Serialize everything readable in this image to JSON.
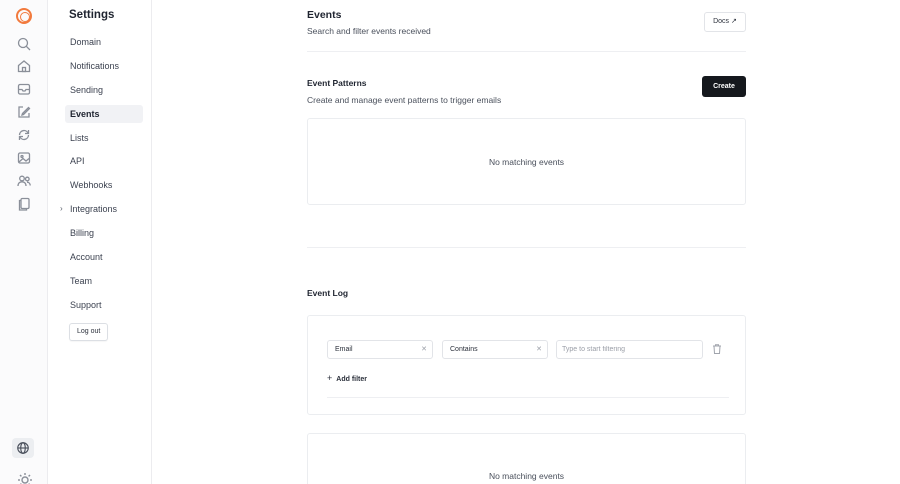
{
  "rail": {
    "icons": [
      "search-icon",
      "home-icon",
      "inbox-icon",
      "compose-icon",
      "sync-icon",
      "media-icon",
      "users-icon",
      "documents-icon"
    ],
    "bottom_icons": [
      "globe-icon",
      "sun-icon"
    ]
  },
  "nav": {
    "title": "Settings",
    "items": [
      {
        "label": "Domain"
      },
      {
        "label": "Notifications"
      },
      {
        "label": "Sending"
      },
      {
        "label": "Events",
        "active": true
      },
      {
        "label": "Lists"
      },
      {
        "label": "API"
      },
      {
        "label": "Webhooks"
      },
      {
        "label": "Integrations",
        "expandable": true
      },
      {
        "label": "Billing"
      },
      {
        "label": "Account"
      },
      {
        "label": "Team"
      },
      {
        "label": "Support"
      }
    ],
    "logout_label": "Log out"
  },
  "header": {
    "title": "Events",
    "subtitle": "Search and filter events received",
    "docs_label": "Docs ↗"
  },
  "patterns": {
    "title": "Event Patterns",
    "subtitle": "Create and manage event patterns to trigger emails",
    "create_label": "Create",
    "empty_text": "No matching events"
  },
  "log": {
    "title": "Event Log",
    "filter": {
      "field_value": "Email",
      "operator_value": "Contains",
      "value_placeholder": "Type to start filtering",
      "clear_glyph": "✕"
    },
    "add_filter_label": "Add filter",
    "empty_text": "No matching events"
  },
  "colors": {
    "brand": "#f27a3d",
    "primary_button": "#15181d",
    "active_nav_bg": "#f1f2f5"
  }
}
